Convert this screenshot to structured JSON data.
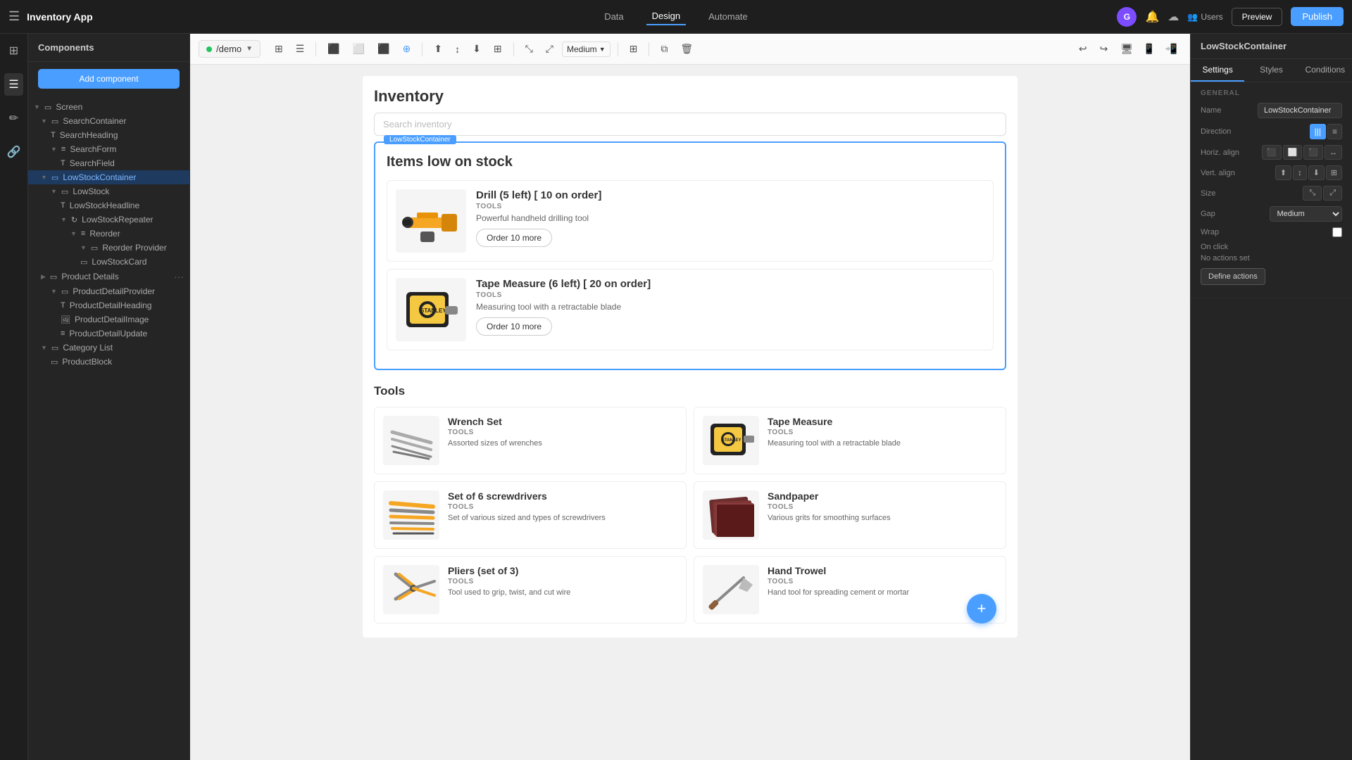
{
  "app": {
    "title": "Inventory App",
    "nav": {
      "items": [
        "Data",
        "Design",
        "Automate"
      ],
      "active": "Design"
    },
    "topbar": {
      "preview_label": "Preview",
      "publish_label": "Publish",
      "users_label": "Users",
      "avatar_letter": "G"
    }
  },
  "sidebar": {
    "header": "Components",
    "add_button": "Add component",
    "tree": [
      {
        "label": "Screen",
        "level": 0,
        "icon": "▭",
        "type": "screen",
        "expanded": true
      },
      {
        "label": "SearchContainer",
        "level": 1,
        "icon": "▭",
        "type": "container",
        "expanded": true
      },
      {
        "label": "SearchHeading",
        "level": 2,
        "icon": "T",
        "type": "text"
      },
      {
        "label": "SearchForm",
        "level": 2,
        "icon": "≡",
        "type": "form",
        "expanded": true
      },
      {
        "label": "SearchField",
        "level": 3,
        "icon": "T",
        "type": "text"
      },
      {
        "label": "LowStockContainer",
        "level": 1,
        "icon": "▭",
        "type": "container",
        "expanded": true,
        "selected": true
      },
      {
        "label": "LowStock",
        "level": 2,
        "icon": "▭",
        "type": "container",
        "expanded": true
      },
      {
        "label": "LowStockHeadline",
        "level": 3,
        "icon": "T",
        "type": "text"
      },
      {
        "label": "LowStockRepeater",
        "level": 3,
        "icon": "🔁",
        "type": "repeater",
        "expanded": true
      },
      {
        "label": "Reorder",
        "level": 4,
        "icon": "≡",
        "type": "container",
        "expanded": true
      },
      {
        "label": "Reorder Provider",
        "level": 5,
        "icon": "▭",
        "type": "provider",
        "expanded": true
      },
      {
        "label": "LowStockCard",
        "level": 6,
        "icon": "▭",
        "type": "card"
      },
      {
        "label": "Product Details",
        "level": 1,
        "icon": "▭",
        "type": "container",
        "expanded": false,
        "hasMenu": true
      },
      {
        "label": "ProductDetailProvider",
        "level": 2,
        "icon": "▭",
        "type": "provider",
        "expanded": true
      },
      {
        "label": "ProductDetailHeading",
        "level": 3,
        "icon": "T",
        "type": "text"
      },
      {
        "label": "ProductDetailImage",
        "level": 3,
        "icon": "🖼",
        "type": "image"
      },
      {
        "label": "ProductDetailUpdate",
        "level": 3,
        "icon": "≡",
        "type": "form"
      },
      {
        "label": "Category List",
        "level": 1,
        "icon": "▭",
        "type": "container",
        "expanded": true
      },
      {
        "label": "ProductBlock",
        "level": 2,
        "icon": "▭",
        "type": "card"
      }
    ]
  },
  "canvas": {
    "env_label": "/demo",
    "toolbar": {
      "medium_label": "Medium"
    }
  },
  "lowstock_panel": {
    "component_name": "LowStockContainer",
    "tabs": [
      "Settings",
      "Styles",
      "Conditions"
    ],
    "active_tab": "Settings",
    "sections": {
      "general_label": "GENERAL",
      "name_label": "Name",
      "name_value": "LowStockContainer",
      "direction_label": "Direction",
      "horiz_align_label": "Horiz. align",
      "vert_align_label": "Vert. align",
      "size_label": "Size",
      "gap_label": "Gap",
      "gap_value": "Medium",
      "wrap_label": "Wrap",
      "on_click_label": "On click",
      "no_actions_label": "No actions set",
      "define_actions_label": "Define actions"
    }
  },
  "inventory": {
    "title": "Inventory",
    "search_placeholder": "Search inventory",
    "low_stock_title": "Items low on stock",
    "low_stock_items": [
      {
        "name": "Drill (5 left) [ 10 on order]",
        "category": "TOOLS",
        "description": "Powerful handheld drilling tool",
        "order_label": "Order 10 more",
        "icon": "🔧"
      },
      {
        "name": "Tape Measure (6 left) [ 20 on order]",
        "category": "TOOLS",
        "description": "Measuring tool with a retractable blade",
        "order_label": "Order 10 more",
        "icon": "📏"
      }
    ],
    "tools_title": "Tools",
    "tool_items": [
      {
        "name": "Wrench Set",
        "category": "TOOLS",
        "description": "Assorted sizes of wrenches",
        "icon": "🔧"
      },
      {
        "name": "Tape Measure",
        "category": "TOOLS",
        "description": "Measuring tool with a retractable blade",
        "icon": "📏"
      },
      {
        "name": "Set of 6 screwdrivers",
        "category": "TOOLS",
        "description": "Set of various sized and types of screwdrivers",
        "icon": "🪛"
      },
      {
        "name": "Sandpaper",
        "category": "TOOLS",
        "description": "Various grits for smoothing surfaces",
        "icon": "📄"
      },
      {
        "name": "Pliers (set of 3)",
        "category": "TOOLS",
        "description": "Tool used to grip, twist, and cut wire",
        "icon": "🔩"
      },
      {
        "name": "Hand Trowel",
        "category": "TOOLS",
        "description": "Hand tool for spreading cement or mortar",
        "icon": "🛠"
      }
    ],
    "fab_icon": "+"
  }
}
